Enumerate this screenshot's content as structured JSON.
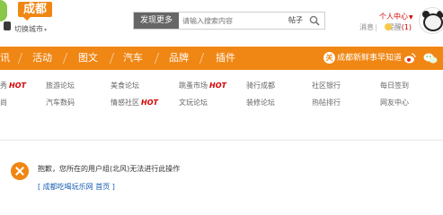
{
  "header": {
    "city": "成都",
    "switch_city": "切换城市",
    "search_category": "发现更多",
    "search_placeholder": "请输入搜索内容",
    "search_type": "帖子",
    "user_center": "个人中心",
    "messages": "消息",
    "separator": "|",
    "remind": "提醒",
    "remind_count": "(1)"
  },
  "nav": {
    "items": [
      "讯",
      "活动",
      "图文",
      "汽车",
      "品牌",
      "插件"
    ],
    "news_badge": "关",
    "news_text": "成都新鲜事早知道"
  },
  "subnav": {
    "row1": [
      "秀",
      "旅游论坛",
      "美食论坛",
      "跳蚤市场",
      "骑行成都",
      "社区银行",
      "每日签到"
    ],
    "row2": [
      "尚",
      "汽车数码",
      "情感社区",
      "文玩论坛",
      "装修论坛",
      "热帖排行",
      "网友中心"
    ],
    "hot_label": "HOT"
  },
  "notice": {
    "message": "抱歉，您所在的用户组(北风)无法进行此操作",
    "link_open": "[",
    "link_text": "成都吃喝玩乐网 首页",
    "link_close": "]"
  },
  "colors": {
    "accent": "#f08613",
    "hot": "#d20000",
    "link": "#1a5fb4"
  }
}
